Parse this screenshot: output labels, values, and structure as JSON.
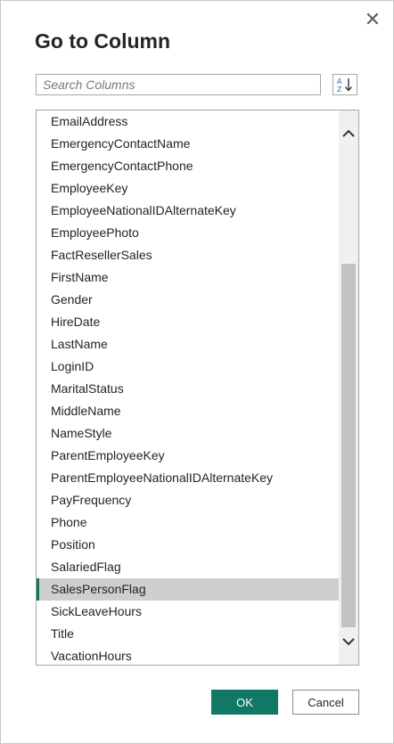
{
  "dialog": {
    "title": "Go to Column",
    "close_glyph": "✕",
    "search": {
      "placeholder": "Search Columns",
      "value": ""
    },
    "sort_button": {
      "icon": "sort-az-icon"
    },
    "columns": [
      "EmailAddress",
      "EmergencyContactName",
      "EmergencyContactPhone",
      "EmployeeKey",
      "EmployeeNationalIDAlternateKey",
      "EmployeePhoto",
      "FactResellerSales",
      "FirstName",
      "Gender",
      "HireDate",
      "LastName",
      "LoginID",
      "MaritalStatus",
      "MiddleName",
      "NameStyle",
      "ParentEmployeeKey",
      "ParentEmployeeNationalIDAlternateKey",
      "PayFrequency",
      "Phone",
      "Position",
      "SalariedFlag",
      "SalesPersonFlag",
      "SickLeaveHours",
      "Title",
      "VacationHours"
    ],
    "selected_column": "SalesPersonFlag",
    "ok_label": "OK",
    "cancel_label": "Cancel"
  },
  "colors": {
    "accent": "#117865",
    "selected_bg": "#cfcfcf",
    "text": "#252423"
  }
}
